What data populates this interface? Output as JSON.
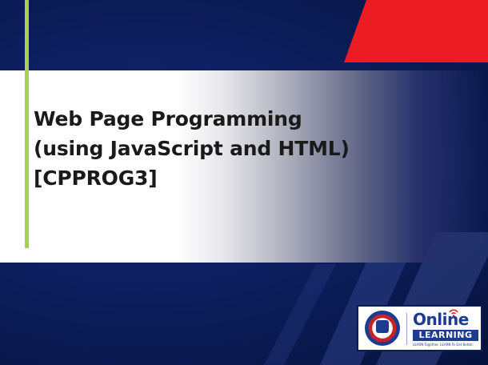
{
  "slide": {
    "title_lines": [
      "Web Page Programming",
      "(using JavaScript and HTML)",
      "[CPPROG3]"
    ]
  },
  "logo": {
    "brand_name": "Online",
    "learning_label": "LEARNING",
    "tagline": "LEARN Together. LEARN To Get Better."
  },
  "colors": {
    "background": "#0b1c58",
    "accent_red": "#ed1c24",
    "accent_green": "#a6d04e",
    "brand_blue": "#1d3b8f"
  }
}
